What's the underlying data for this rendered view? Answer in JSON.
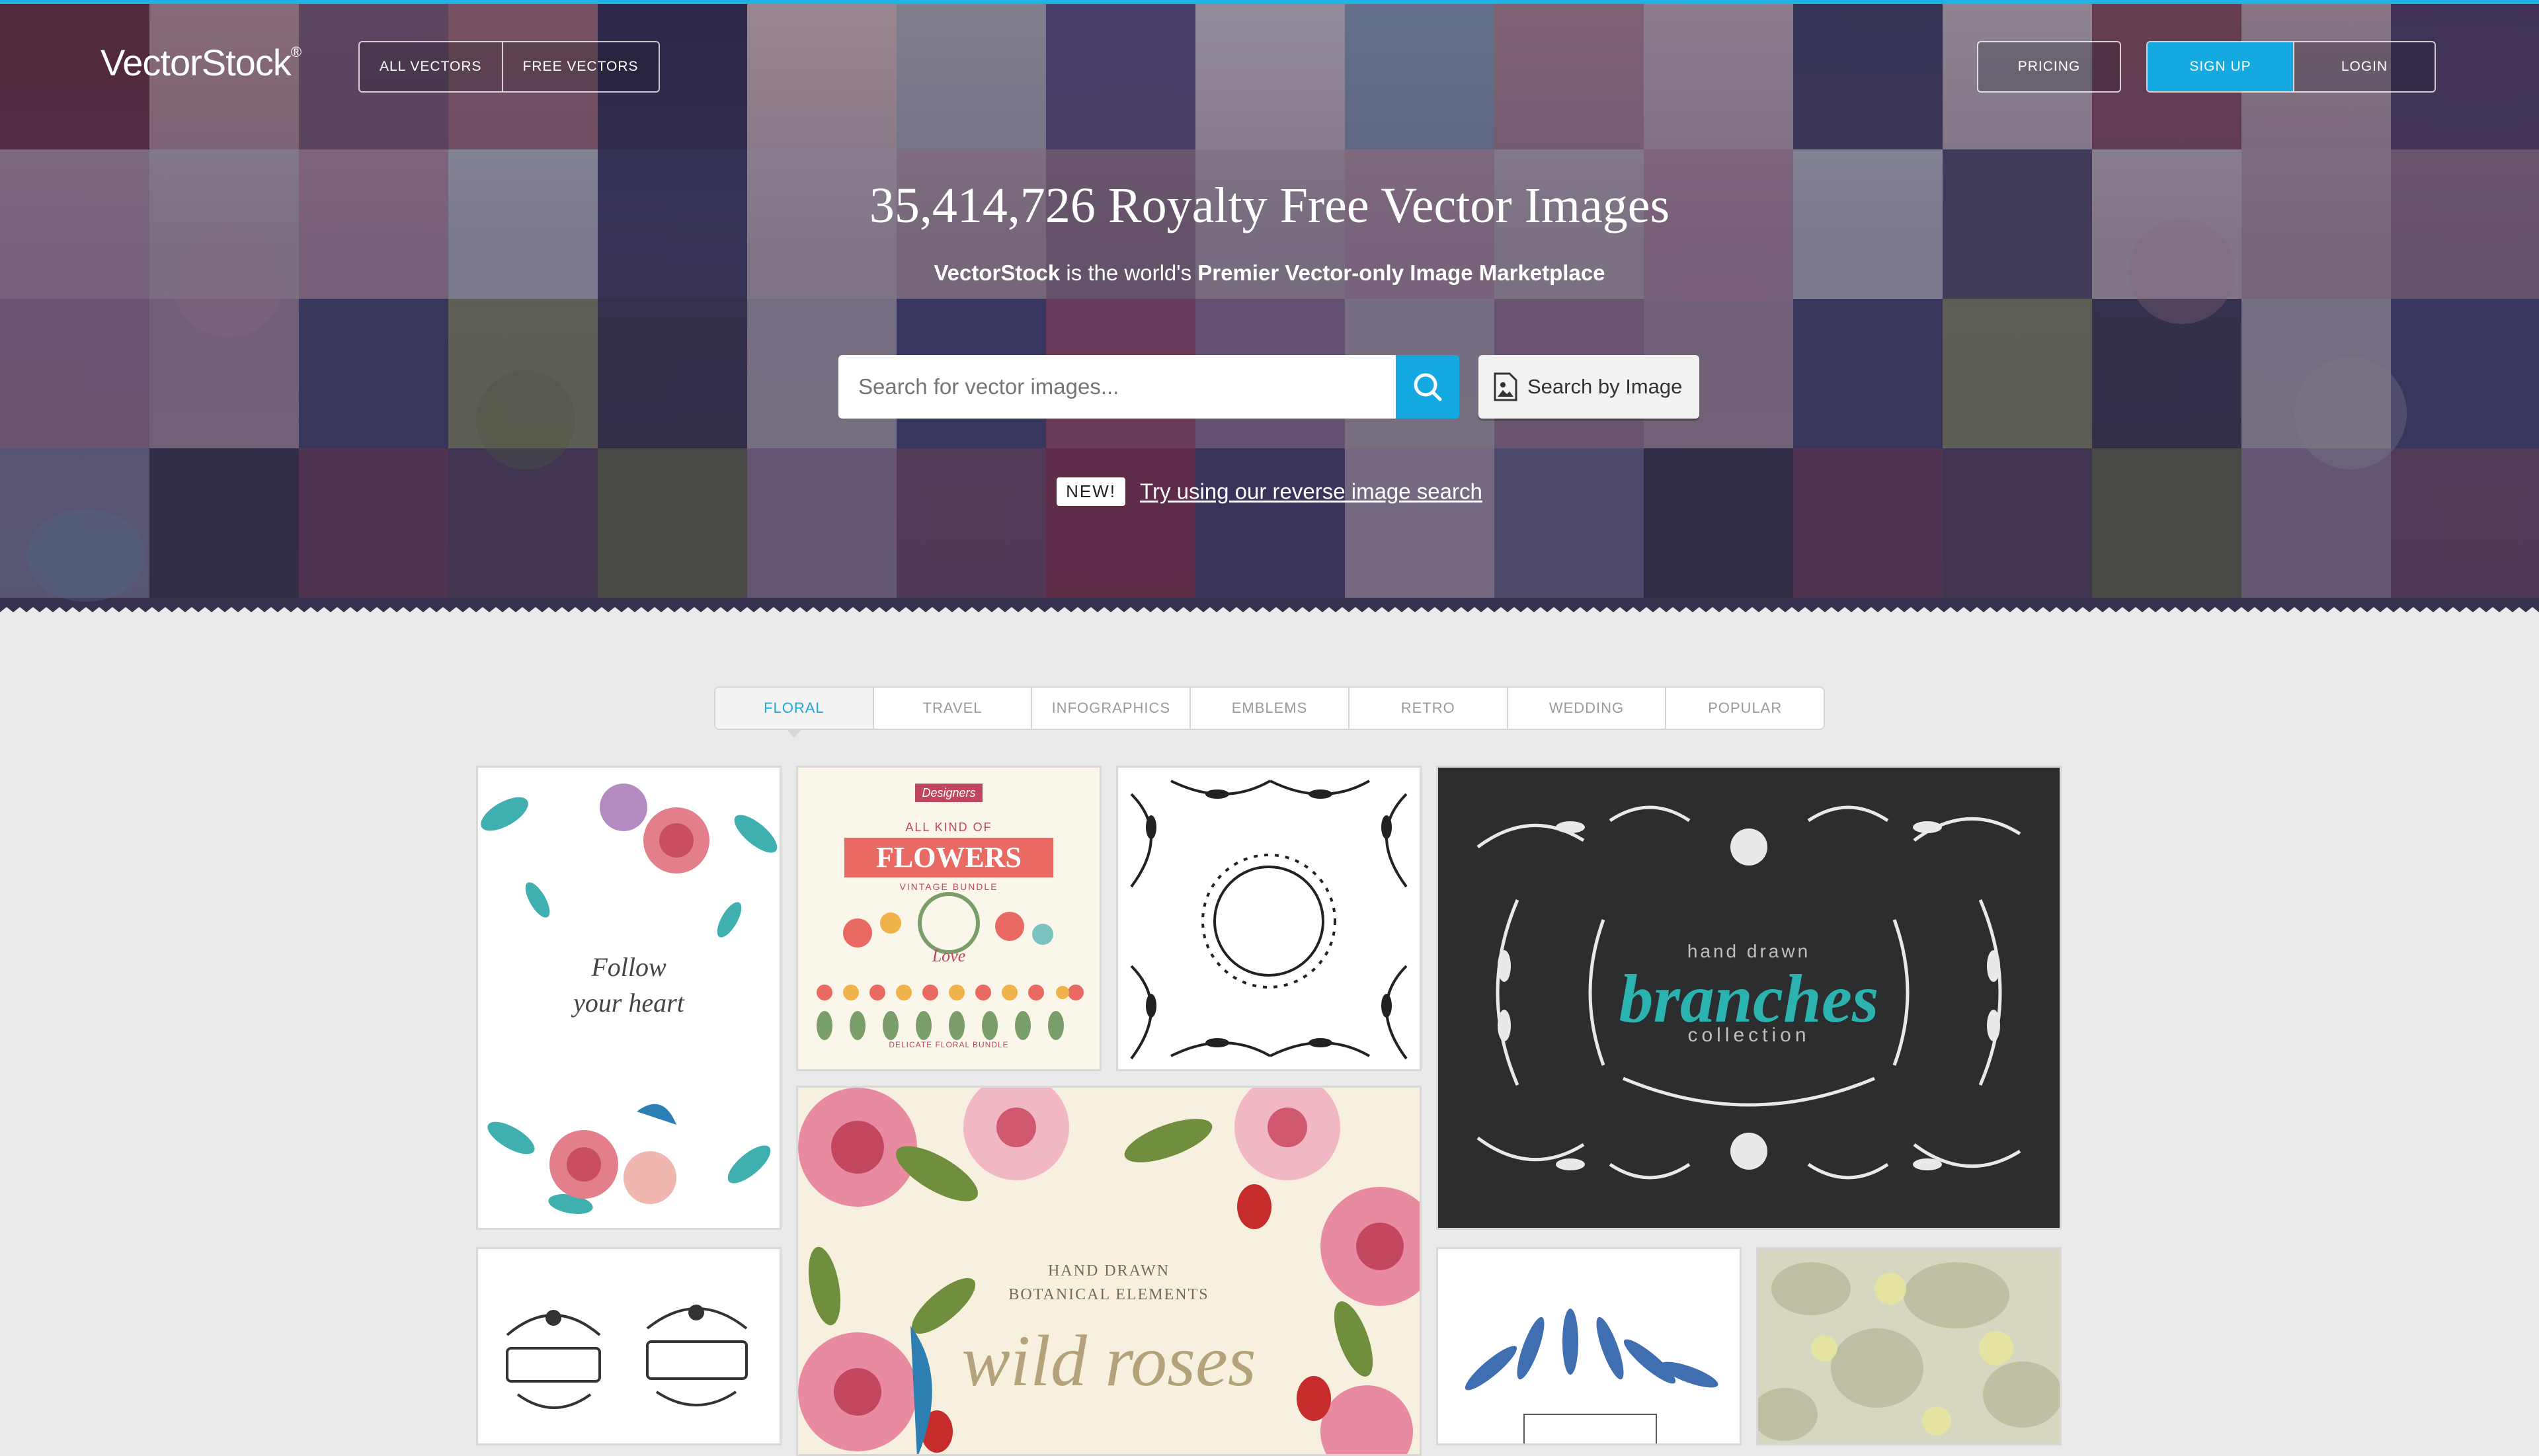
{
  "header": {
    "logo_text": "VectorStock",
    "logo_mark": "®",
    "nav_left": [
      "ALL VECTORS",
      "FREE VECTORS"
    ],
    "nav_right": [
      "PRICING"
    ],
    "auth": [
      "SIGN UP",
      "LOGIN"
    ]
  },
  "hero": {
    "headline": "35,414,726 Royalty Free Vector Images",
    "sub_brand": "VectorStock",
    "sub_mid": " is the world's ",
    "sub_bold": "Premier Vector-only Image Marketplace",
    "search_placeholder": "Search for vector images...",
    "image_search_label": "Search by Image",
    "new_badge": "NEW!",
    "new_link": "Try using our reverse image search"
  },
  "tabs": [
    "FLORAL",
    "TRAVEL",
    "INFOGRAPHICS",
    "EMBLEMS",
    "RETRO",
    "WEDDING",
    "POPULAR"
  ],
  "tiles": {
    "card1": [
      "Follow",
      "your heart"
    ],
    "card2": {
      "badge": "Designers",
      "line1": "ALL KIND OF",
      "title": "FLOWERS",
      "subtitle": "VINTAGE BUNDLE",
      "word": "Love",
      "footer": "DELICATE FLORAL BUNDLE"
    },
    "card4": {
      "small": "hand drawn",
      "title": "branches",
      "footer": "collection"
    },
    "card6": {
      "line1": "HAND DRAWN",
      "line2": "BOTANICAL ELEMENTS",
      "title": "wild roses"
    }
  },
  "colors": {
    "accent": "#14a9e0",
    "page_bg": "#e9eae9",
    "hero_overlay": "#3b3647"
  }
}
